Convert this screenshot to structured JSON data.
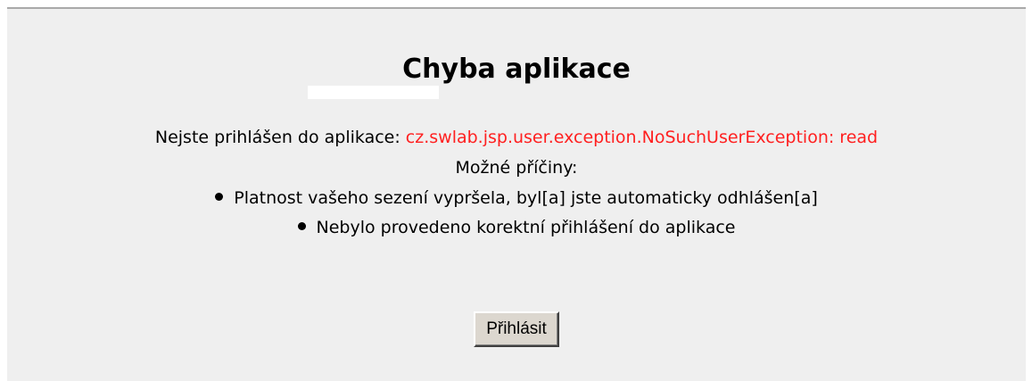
{
  "page": {
    "title": "Chyba aplikace",
    "message_prefix": "Nejste prihlášen do aplikace: ",
    "error_text": "cz.swlab.jsp.user.exception.NoSuchUserException: read",
    "causes_heading": "Možné příčiny:",
    "causes": [
      "Platnost vašeho sezení vypršela, byl[a] jste automaticky odhlášen[a]",
      "Nebylo provedeno korektní přihlášení do aplikace"
    ],
    "login_button": "Přihlásit"
  },
  "colors": {
    "panel_background": "#efefef",
    "error_text": "#ff2020",
    "button_face": "#dcd7cf"
  }
}
